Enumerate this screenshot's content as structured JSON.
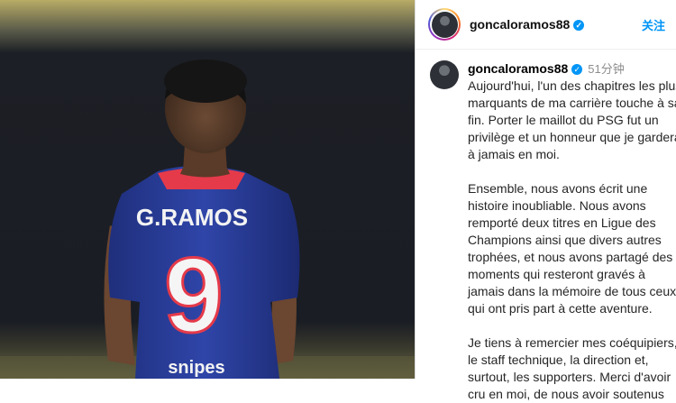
{
  "header": {
    "username": "goncaloramos88",
    "follow_label": "关注"
  },
  "post": {
    "username": "goncaloramos88",
    "time": "51分钟",
    "caption": "Aujourd'hui, l'un des chapitres les plus marquants de ma carrière touche à sa fin. Porter le maillot du PSG fut un privilège et un honneur que je garderai à jamais en moi.\n\nEnsemble, nous avons écrit une histoire inoubliable. Nous avons remporté deux titres en Ligue des Champions ainsi que divers autres trophées, et nous avons partagé des moments qui resteront gravés à jamais dans la mémoire de tous ceux qui ont pris part à cette aventure.\n\nJe tiens à remercier mes coéquipiers, le staff technique, la direction et, surtout, les supporters. Merci d'avoir cru en moi, de nous avoir soutenus"
  },
  "photo": {
    "jersey_name": "G.RAMOS",
    "jersey_number": "9",
    "sponsor": "snipes"
  },
  "colors": {
    "jersey_blue": "#2b3f9e",
    "jersey_red": "#e53a4a",
    "link_blue": "#0095f6"
  }
}
